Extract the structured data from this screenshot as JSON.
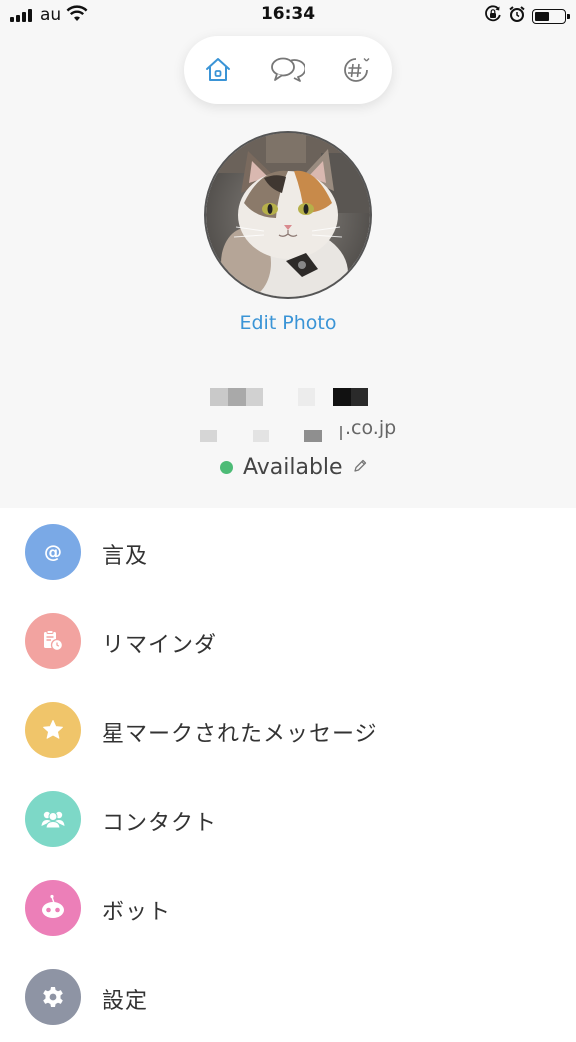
{
  "status_bar": {
    "carrier": "au",
    "time": "16:34"
  },
  "tabs": [
    {
      "name": "home-icon"
    },
    {
      "name": "chat-icon"
    },
    {
      "name": "channel-icon"
    }
  ],
  "profile": {
    "edit_photo_label": "Edit Photo",
    "email_suffix": ".co.jp",
    "status": "Available"
  },
  "menu": [
    {
      "label": "言及",
      "icon": "at-icon",
      "color": "#7aa9e6"
    },
    {
      "label": "リマインダ",
      "icon": "reminder-icon",
      "color": "#f2a3a0"
    },
    {
      "label": "星マークされたメッセージ",
      "icon": "star-icon",
      "color": "#f0c56a"
    },
    {
      "label": "コンタクト",
      "icon": "contacts-icon",
      "color": "#7dd8c7"
    },
    {
      "label": "ボット",
      "icon": "bot-icon",
      "color": "#ec7fb8"
    },
    {
      "label": "設定",
      "icon": "gear-icon",
      "color": "#8e94a4"
    }
  ],
  "colors": {
    "accent": "#3a94d6",
    "available": "#4dbb76"
  }
}
